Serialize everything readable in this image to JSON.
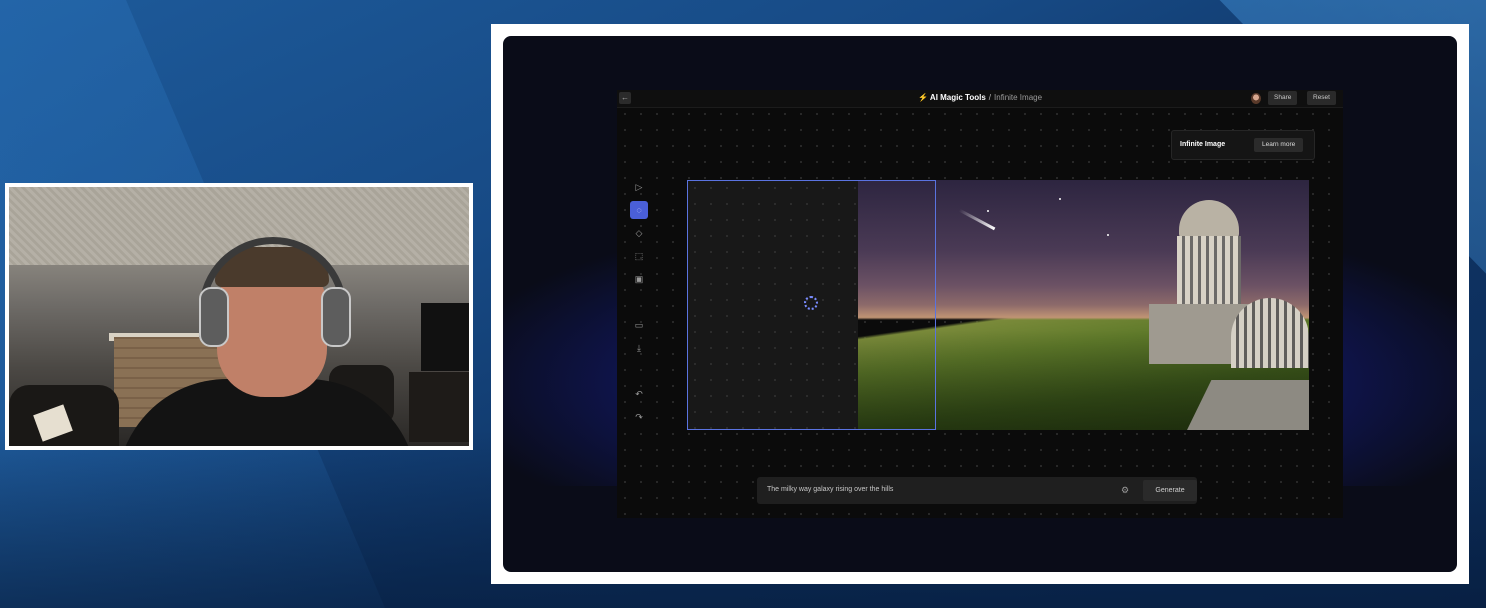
{
  "app": {
    "breadcrumb_root": "AI Magic Tools",
    "breadcrumb_separator": "/",
    "breadcrumb_page": "Infinite Image",
    "share_label": "Share",
    "reset_label": "Reset"
  },
  "info_panel": {
    "title": "Infinite Image",
    "learn_more_label": "Learn more"
  },
  "toolbar": {
    "tools": [
      {
        "name": "select-icon",
        "glyph": "▷"
      },
      {
        "name": "generation-frame-icon",
        "glyph": "◌",
        "active": true
      },
      {
        "name": "eraser-icon",
        "glyph": "◇"
      },
      {
        "name": "crop-icon",
        "glyph": "⬚"
      },
      {
        "name": "image-icon",
        "glyph": "▣"
      },
      {
        "name": "folder-icon",
        "glyph": "▭"
      },
      {
        "name": "download-icon",
        "glyph": "⤓"
      },
      {
        "name": "undo-icon",
        "glyph": "↶"
      },
      {
        "name": "redo-icon",
        "glyph": "↷"
      }
    ]
  },
  "prompt": {
    "value": "The milky way galaxy rising over the hills",
    "generate_label": "Generate"
  },
  "colors": {
    "accent": "#4a5fd8",
    "frame_border": "#5a73e0"
  }
}
